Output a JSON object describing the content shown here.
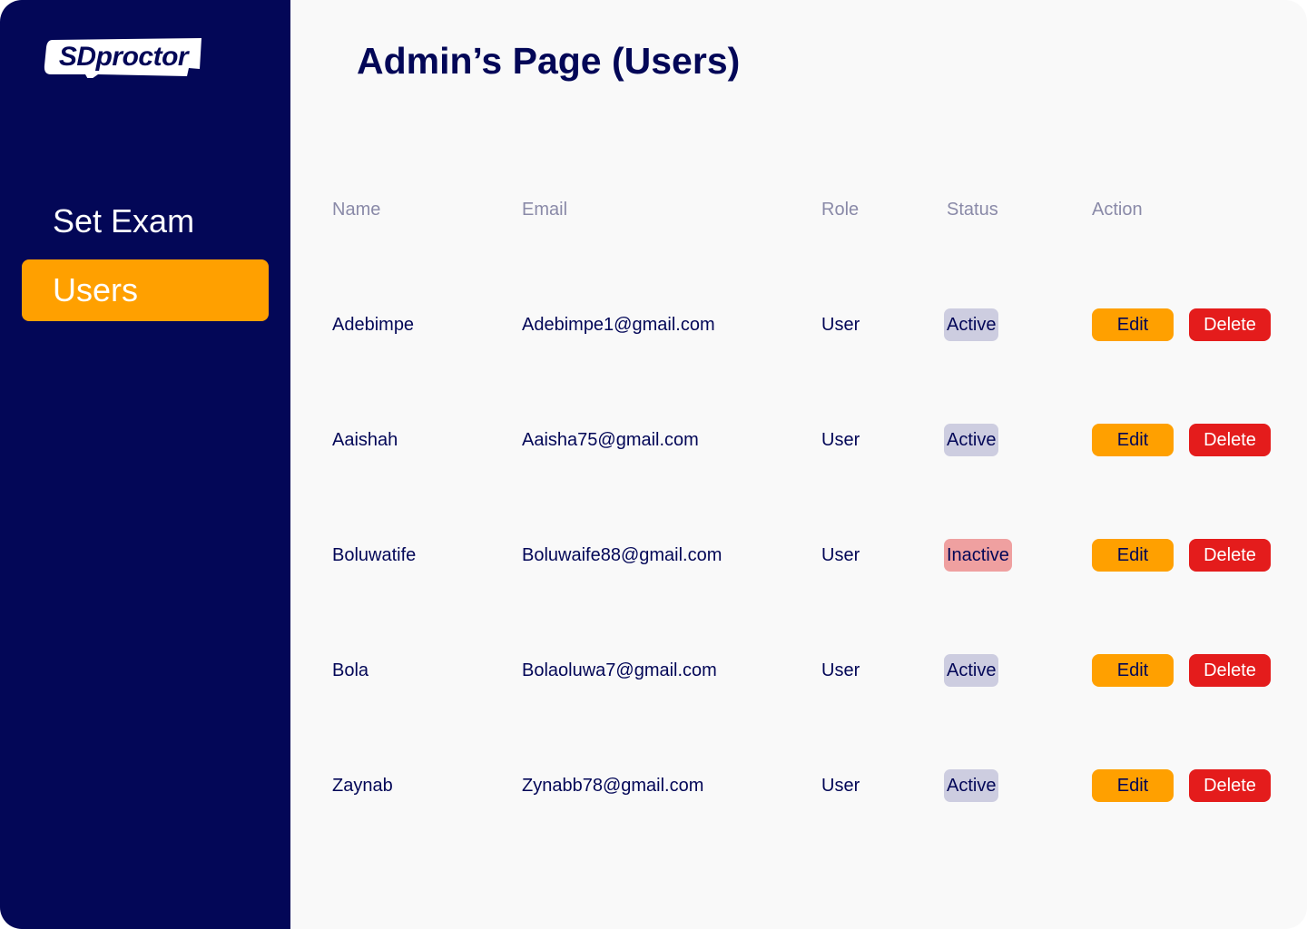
{
  "app": {
    "logo_text": "SDproctor",
    "colors": {
      "sidebar_bg": "#030757",
      "accent": "#ffa000",
      "danger": "#e41c1c",
      "active_badge": "#cdcde0",
      "inactive_badge": "#efa0a0",
      "text_primary": "#030757"
    }
  },
  "sidebar": {
    "items": [
      {
        "label": "Set Exam",
        "selected": false
      },
      {
        "label": "Users",
        "selected": true
      }
    ]
  },
  "main": {
    "title": "Admin’s Page (Users)",
    "table": {
      "headers": [
        "Name",
        "Email",
        "Role",
        "Status",
        "Action"
      ],
      "rows": [
        {
          "name": "Adebimpe",
          "email": "Adebimpe1@gmail.com",
          "role": "User",
          "status": "Active",
          "edit": "Edit",
          "delete": "Delete"
        },
        {
          "name": "Aaishah",
          "email": "Aaisha75@gmail.com",
          "role": "User",
          "status": "Active",
          "edit": "Edit",
          "delete": "Delete"
        },
        {
          "name": "Boluwatife",
          "email": "Boluwaife88@gmail.com",
          "role": "User",
          "status": "Inactive",
          "edit": "Edit",
          "delete": "Delete"
        },
        {
          "name": "Bola",
          "email": "Bolaoluwa7@gmail.com",
          "role": "User",
          "status": "Active",
          "edit": "Edit",
          "delete": "Delete"
        },
        {
          "name": "Zaynab",
          "email": "Zynabb78@gmail.com",
          "role": "User",
          "status": "Active",
          "edit": "Edit",
          "delete": "Delete"
        }
      ]
    }
  }
}
